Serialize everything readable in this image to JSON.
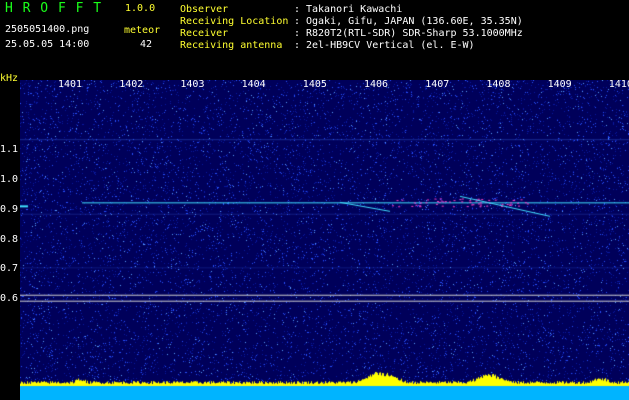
{
  "header": {
    "brand": "H R O F F T",
    "version": "1.0.0",
    "filename": "2505051400.png",
    "datetime": "25.05.05 14:00",
    "count_label": "meteor",
    "count_value": "42"
  },
  "station_info": [
    {
      "label": "Observer",
      "value": "Takanori Kawachi"
    },
    {
      "label": "Receiving Location",
      "value": "Ogaki, Gifu, JAPAN (136.60E, 35.35N)"
    },
    {
      "label": "Receiver",
      "value": "R820T2(RTL-SDR) SDR-Sharp 53.1000MHz"
    },
    {
      "label": "Receiving antenna",
      "value": "2el-HB9CV Vertical (el. E-W)"
    }
  ],
  "chart_data": {
    "type": "heatmap",
    "ylabel": "kHz",
    "x_ticks": [
      "1401",
      "1402",
      "1403",
      "1404",
      "1405",
      "1406",
      "1407",
      "1408",
      "1409",
      "1410"
    ],
    "y_ticks": [
      "1.1",
      "1.0",
      "0.9",
      "0.8",
      "0.7",
      "0.6"
    ],
    "carrier_khz": 0.925,
    "colors": {
      "background": "#00005a",
      "noise": "#2850ff",
      "carrier": "#40e0ff",
      "meteor_hot": "#ff3cc8",
      "bottom_band": "#00b4ff",
      "bottom_peaks": "#ffff00"
    }
  }
}
